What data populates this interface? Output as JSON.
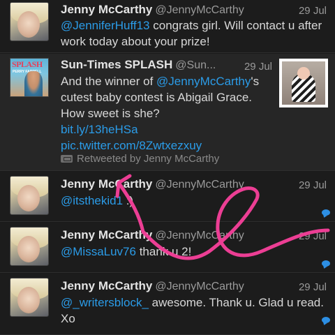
{
  "colors": {
    "background": "#1a1a1a",
    "mention": "#2b9ce8",
    "annotation": "#ec3e94"
  },
  "tweets": [
    {
      "name": "Jenny McCarthy",
      "handle": "@JennyMcCarthy",
      "time": "29 Jul",
      "mention": "@JenniferHuff13",
      "text": "  congrats girl. Will contact u after work today about your prize!"
    },
    {
      "name": "Sun-Times SPLASH",
      "handle": "@Sun...",
      "time": "29 Jul",
      "avatar_text": "SPLASH",
      "avatar_sub": "PERRY FARRELL",
      "text_before": "And the winner of ",
      "mention": "@JennyMcCarthy",
      "text_after": "'s cutest baby contest is Abigail Grace. How sweet is she?",
      "link1": "bit.ly/13heHSa",
      "link2": "pic.twitter.com/8Zwtxezxuy",
      "retweeted_by": "Retweeted by Jenny McCarthy"
    },
    {
      "name": "Jenny McCarthy",
      "handle": "@JennyMcCarthy",
      "time": "29 Jul",
      "mention": "@itsthekid1",
      "text": " :)"
    },
    {
      "name": "Jenny McCarthy",
      "handle": "@JennyMcCarthy",
      "time": "29 Jul",
      "mention": "@MissaLuv76",
      "text": "  thank u 2!"
    },
    {
      "name": "Jenny McCarthy",
      "handle": "@JennyMcCarthy",
      "time": "29 Jul",
      "mention": "@_writersblock_",
      "text": "  awesome. Thank u. Glad u read. Xo"
    }
  ]
}
